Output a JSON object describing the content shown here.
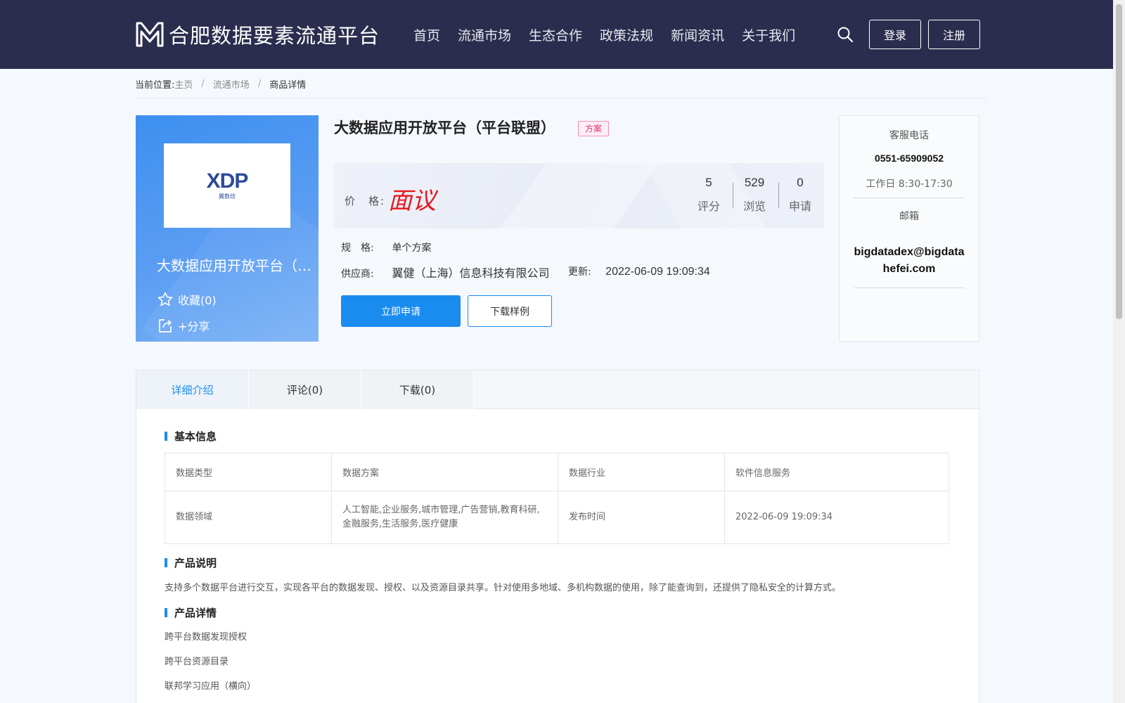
{
  "header": {
    "site_name": "合肥数据要素流通平台",
    "nav": [
      "首页",
      "流通市场",
      "生态合作",
      "政策法规",
      "新闻资讯",
      "关于我们"
    ],
    "login_label": "登录",
    "register_label": "注册"
  },
  "breadcrumb": {
    "label": "当前位置:",
    "items": [
      "主页",
      "流通市场"
    ],
    "current": "商品详情"
  },
  "product": {
    "logo_text": "XDP",
    "logo_sub": "翼数坊",
    "card_title": "大数据应用开放平台（…",
    "title": "大数据应用开放平台（平台联盟）",
    "tag": "方案",
    "favorite_label": "收藏(0)",
    "share_label": "+分享",
    "price_label": "价　格:",
    "price_value": "面议",
    "stats": [
      {
        "value": "5",
        "label": "评分"
      },
      {
        "value": "529",
        "label": "浏览"
      },
      {
        "value": "0",
        "label": "申请"
      }
    ],
    "spec_label": "规　格:",
    "spec_value": "单个方案",
    "supplier_label": "供应商:",
    "supplier_value": "翼健（上海）信息科技有限公司",
    "update_label": "更新:",
    "update_value": "2022-06-09 19:09:34",
    "apply_label": "立即申请",
    "download_label": "下载样例"
  },
  "contact": {
    "phone_label": "客服电话",
    "phone": "0551-65909052",
    "hours": "工作日 8:30-17:30",
    "email_label": "邮箱",
    "email": "bigdatadex@bigdatahefei.com"
  },
  "tabs": [
    "详细介绍",
    "评论(0)",
    "下载(0)"
  ],
  "detail": {
    "basic_title": "基本信息",
    "table": {
      "row1": [
        "数据类型",
        "数据方案",
        "数据行业",
        "软件信息服务"
      ],
      "row2": [
        "数据领域",
        "人工智能,企业服务,城市管理,广告营销,教育科研,金融服务,生活服务,医疗健康",
        "发布时间",
        "2022-06-09 19:09:34"
      ]
    },
    "desc_title": "产品说明",
    "desc_text": "支持多个数据平台进行交互，实现各平台的数据发现、授权、以及资源目录共享。针对使用多地域、多机构数据的使用，除了能查询到，还提供了隐私安全的计算方式。",
    "detail_title": "产品详情",
    "detail_items": [
      "跨平台数据发现授权",
      "跨平台资源目录",
      "联邦学习应用（横向）"
    ]
  }
}
